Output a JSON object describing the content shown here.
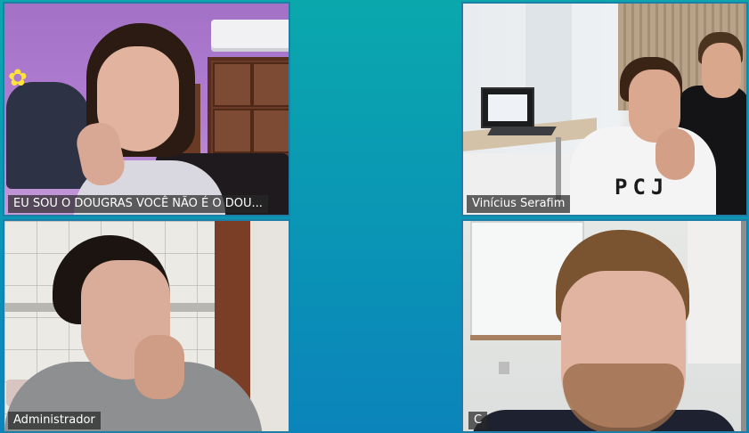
{
  "participants": [
    {
      "name": "EU SOU O DOUGRAS VOCÊ NÃO É O DOU..."
    },
    {
      "name": "Vinícius Serafim"
    },
    {
      "name": "Administrador"
    },
    {
      "name": "C"
    }
  ],
  "shirt_print": "PCJ",
  "colors": {
    "background_top": "#0aa8ad",
    "background_bottom": "#0b84bb",
    "tile_border": "#1e7ea8",
    "name_tag_bg": "#3a3a3a"
  }
}
